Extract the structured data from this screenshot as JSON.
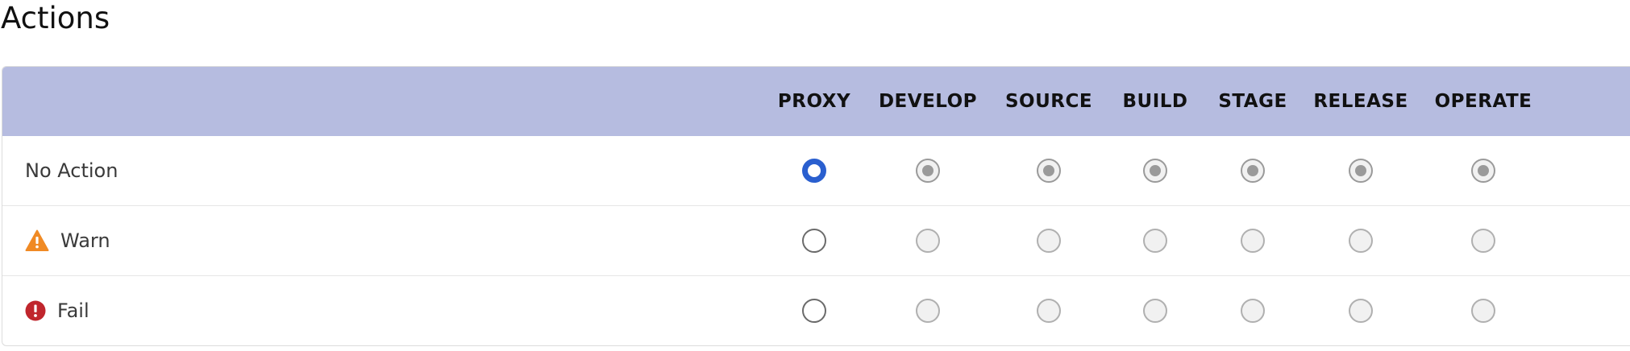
{
  "page": {
    "title": "Actions"
  },
  "table": {
    "columns": [
      "PROXY",
      "DEVELOP",
      "SOURCE",
      "BUILD",
      "STAGE",
      "RELEASE",
      "OPERATE"
    ],
    "rows": [
      {
        "label": "No Action",
        "icon": "",
        "values": [
          "selected",
          "disabled-checked",
          "disabled-checked",
          "disabled-checked",
          "disabled-checked",
          "disabled-checked",
          "disabled-checked"
        ]
      },
      {
        "label": "Warn",
        "icon": "warning-triangle-icon",
        "values": [
          "empty",
          "disabled",
          "disabled",
          "disabled",
          "disabled",
          "disabled",
          "disabled"
        ]
      },
      {
        "label": "Fail",
        "icon": "error-circle-icon",
        "values": [
          "empty",
          "disabled",
          "disabled",
          "disabled",
          "disabled",
          "disabled",
          "disabled"
        ]
      }
    ]
  },
  "colors": {
    "header_bg": "#b6bce0",
    "selected": "#2a5fcf",
    "warn": "#f08a24",
    "fail": "#c0262d"
  }
}
